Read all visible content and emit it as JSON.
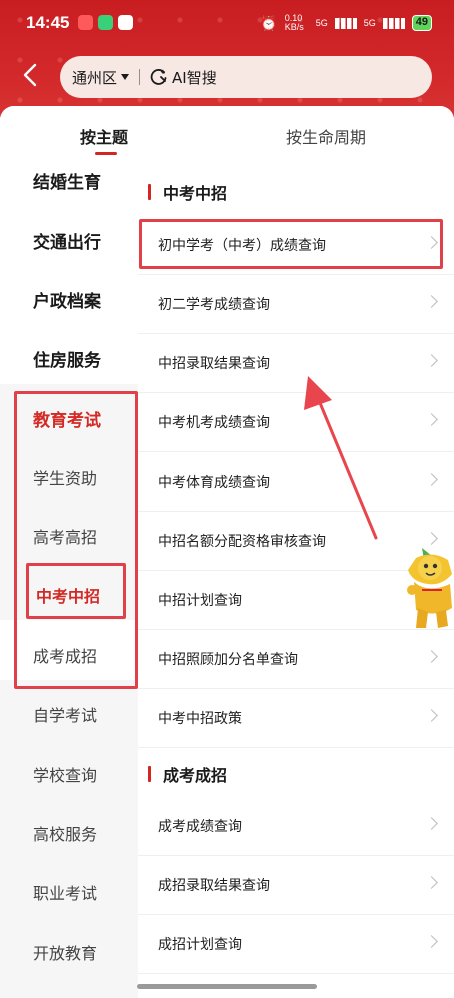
{
  "status_bar": {
    "time": "14:45",
    "net_speed": "0.10 KB/s",
    "network_1": "5G",
    "network_2": "5G",
    "battery": "49"
  },
  "search": {
    "district": "通州区",
    "placeholder": "AI智搜"
  },
  "tabs": [
    {
      "label": "按主题",
      "active": true
    },
    {
      "label": "按生命周期",
      "active": false
    }
  ],
  "sidebar": {
    "items": [
      {
        "label": "结婚生育"
      },
      {
        "label": "交通出行"
      },
      {
        "label": "户政档案"
      },
      {
        "label": "住房服务"
      },
      {
        "label": "教育考试"
      },
      {
        "label": "学生资助"
      },
      {
        "label": "高考高招"
      },
      {
        "label": "中考中招"
      },
      {
        "label": "成考成招"
      },
      {
        "label": "自学考试"
      },
      {
        "label": "学校查询"
      },
      {
        "label": "高校服务"
      },
      {
        "label": "职业考试"
      },
      {
        "label": "开放教育"
      }
    ]
  },
  "content": {
    "sections": [
      {
        "title": "中考中招",
        "items": [
          "初中学考（中考）成绩查询",
          "初二学考成绩查询",
          "中招录取结果查询",
          "中考机考成绩查询",
          "中考体育成绩查询",
          "中招名额分配资格审核查询",
          "中招计划查询",
          "中招照顾加分名单查询",
          "中考中招政策"
        ]
      },
      {
        "title": "成考成招",
        "items": [
          "成考成绩查询",
          "成招录取结果查询",
          "成招计划查询"
        ]
      }
    ]
  },
  "colors": {
    "brand_red": "#d5251f",
    "highlight_outline": "#e0404a"
  }
}
